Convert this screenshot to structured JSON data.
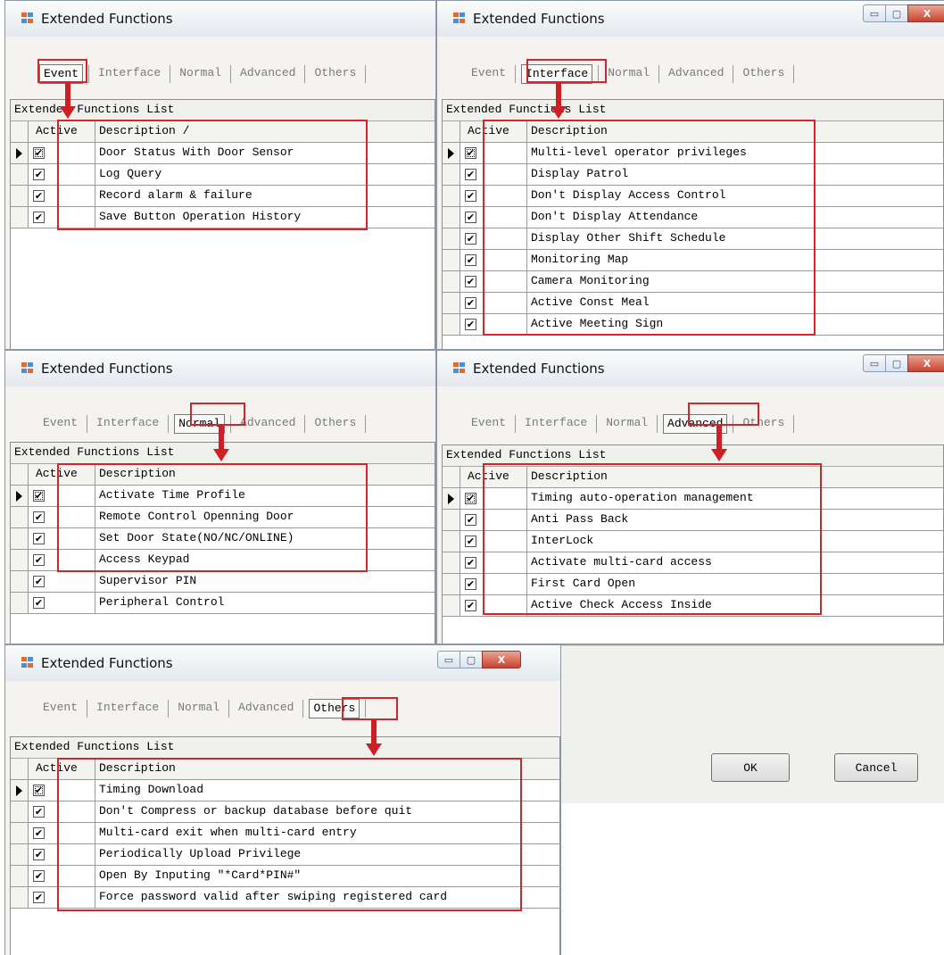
{
  "window_title": "Extended Functions",
  "window_controls": {
    "minimize": "▭",
    "maximize": "▢",
    "close": "X"
  },
  "tabs": [
    "Event",
    "Interface",
    "Normal",
    "Advanced",
    "Others"
  ],
  "list_title": "Extended Functions List",
  "columns": {
    "active": "Active",
    "description": "Description"
  },
  "panels": {
    "event": {
      "description_header": "Description /",
      "rows": [
        "Door Status With Door Sensor",
        "Log Query",
        "Record alarm & failure",
        "Save Button Operation History"
      ]
    },
    "interface": {
      "description_header": "Description",
      "rows": [
        "Multi-level operator privileges",
        "Display Patrol",
        "Don't Display Access Control",
        "Don't Display Attendance",
        "Display Other Shift Schedule",
        "Monitoring Map",
        "Camera Monitoring",
        "Active Const Meal",
        "Active Meeting Sign"
      ]
    },
    "normal": {
      "description_header": "Description",
      "rows": [
        "Activate Time Profile",
        "Remote Control Openning Door",
        "Set Door State(NO/NC/ONLINE)",
        "Access Keypad",
        "Supervisor PIN",
        "Peripheral Control"
      ]
    },
    "advanced": {
      "description_header": "Description",
      "rows": [
        "Timing auto-operation management",
        "Anti Pass Back",
        "InterLock",
        "Activate multi-card access",
        "First Card Open",
        "Active Check Access Inside"
      ]
    },
    "others": {
      "description_header": "Description",
      "rows": [
        "Timing Download",
        "Don't Compress or backup database before quit",
        "Multi-card exit when multi-card entry",
        "Periodically Upload Privilege",
        "Open By Inputing \"*Card*PIN#\"",
        "Force password valid after swiping registered card"
      ]
    }
  },
  "checkbox_mark": "✔",
  "buttons": {
    "ok": "OK",
    "cancel": "Cancel"
  },
  "colors": {
    "highlight": "#d3262c",
    "arrow": "#cf1e24"
  }
}
